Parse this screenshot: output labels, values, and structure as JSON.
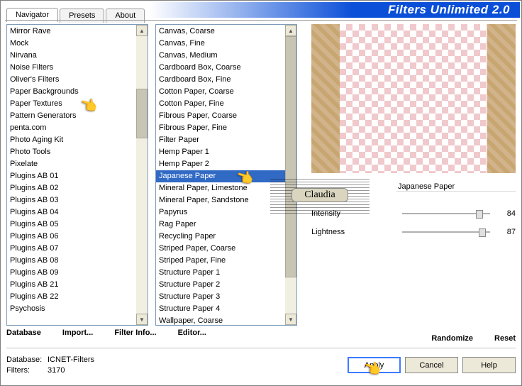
{
  "title": "Filters Unlimited 2.0",
  "tabs": {
    "t0": "Navigator",
    "t1": "Presets",
    "t2": "About"
  },
  "left_list": [
    "Mirror Rave",
    "Mock",
    "Nirvana",
    "Noise Filters",
    "Oliver's Filters",
    "Paper Backgrounds",
    "Paper Textures",
    "Pattern Generators",
    "penta.com",
    "Photo Aging Kit",
    "Photo Tools",
    "Pixelate",
    "Plugins AB 01",
    "Plugins AB 02",
    "Plugins AB 03",
    "Plugins AB 04",
    "Plugins AB 05",
    "Plugins AB 06",
    "Plugins AB 07",
    "Plugins AB 08",
    "Plugins AB 09",
    "Plugins AB 21",
    "Plugins AB 22",
    "Psychosis"
  ],
  "mid_list": [
    "Canvas, Coarse",
    "Canvas, Fine",
    "Canvas, Medium",
    "Cardboard Box, Coarse",
    "Cardboard Box, Fine",
    "Cotton Paper, Coarse",
    "Cotton Paper, Fine",
    "Fibrous Paper, Coarse",
    "Fibrous Paper, Fine",
    "Filter Paper",
    "Hemp Paper 1",
    "Hemp Paper 2",
    "Japanese Paper",
    "Mineral Paper, Limestone",
    "Mineral Paper, Sandstone",
    "Papyrus",
    "Rag Paper",
    "Recycling Paper",
    "Striped Paper, Coarse",
    "Striped Paper, Fine",
    "Structure Paper 1",
    "Structure Paper 2",
    "Structure Paper 3",
    "Structure Paper 4",
    "Wallpaper, Coarse"
  ],
  "mid_selected_index": 12,
  "filter_name": "Japanese Paper",
  "params": {
    "intensity_label": "Intensity",
    "intensity_value": "84",
    "lightness_label": "Lightness",
    "lightness_value": "87"
  },
  "buttons": {
    "database": "Database",
    "import": "Import...",
    "filterinfo": "Filter Info...",
    "editor": "Editor...",
    "randomize": "Randomize",
    "reset": "Reset",
    "apply": "Apply",
    "cancel": "Cancel",
    "help": "Help"
  },
  "footer": {
    "db_label": "Database:",
    "db_value": "ICNET-Filters",
    "filters_label": "Filters:",
    "filters_value": "3170"
  },
  "watermark": "Claudia"
}
